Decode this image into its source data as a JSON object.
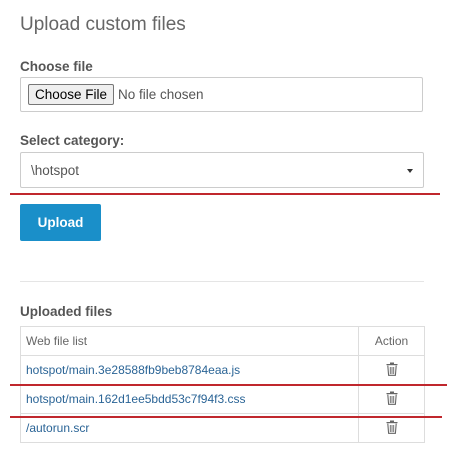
{
  "page": {
    "title": "Upload custom files"
  },
  "file_input": {
    "label": "Choose file",
    "button_label": "Choose File",
    "status": "No file chosen"
  },
  "category": {
    "label": "Select category:",
    "selected": "\\hotspot"
  },
  "upload": {
    "button_label": "Upload"
  },
  "uploaded": {
    "heading": "Uploaded files",
    "columns": {
      "file_list": "Web file list",
      "action": "Action"
    },
    "rows": [
      {
        "file": "hotspot/main.3e28588fb9beb8784eaa.js",
        "action_icon": "trash-icon"
      },
      {
        "file": "hotspot/main.162d1ee5bdd53c7f94f3.css",
        "action_icon": "trash-icon"
      },
      {
        "file": "/autorun.scr",
        "action_icon": "trash-icon"
      }
    ]
  },
  "colors": {
    "accent": "#1a8fc9",
    "link": "#2a6496",
    "annotation_line": "#c0272d"
  }
}
